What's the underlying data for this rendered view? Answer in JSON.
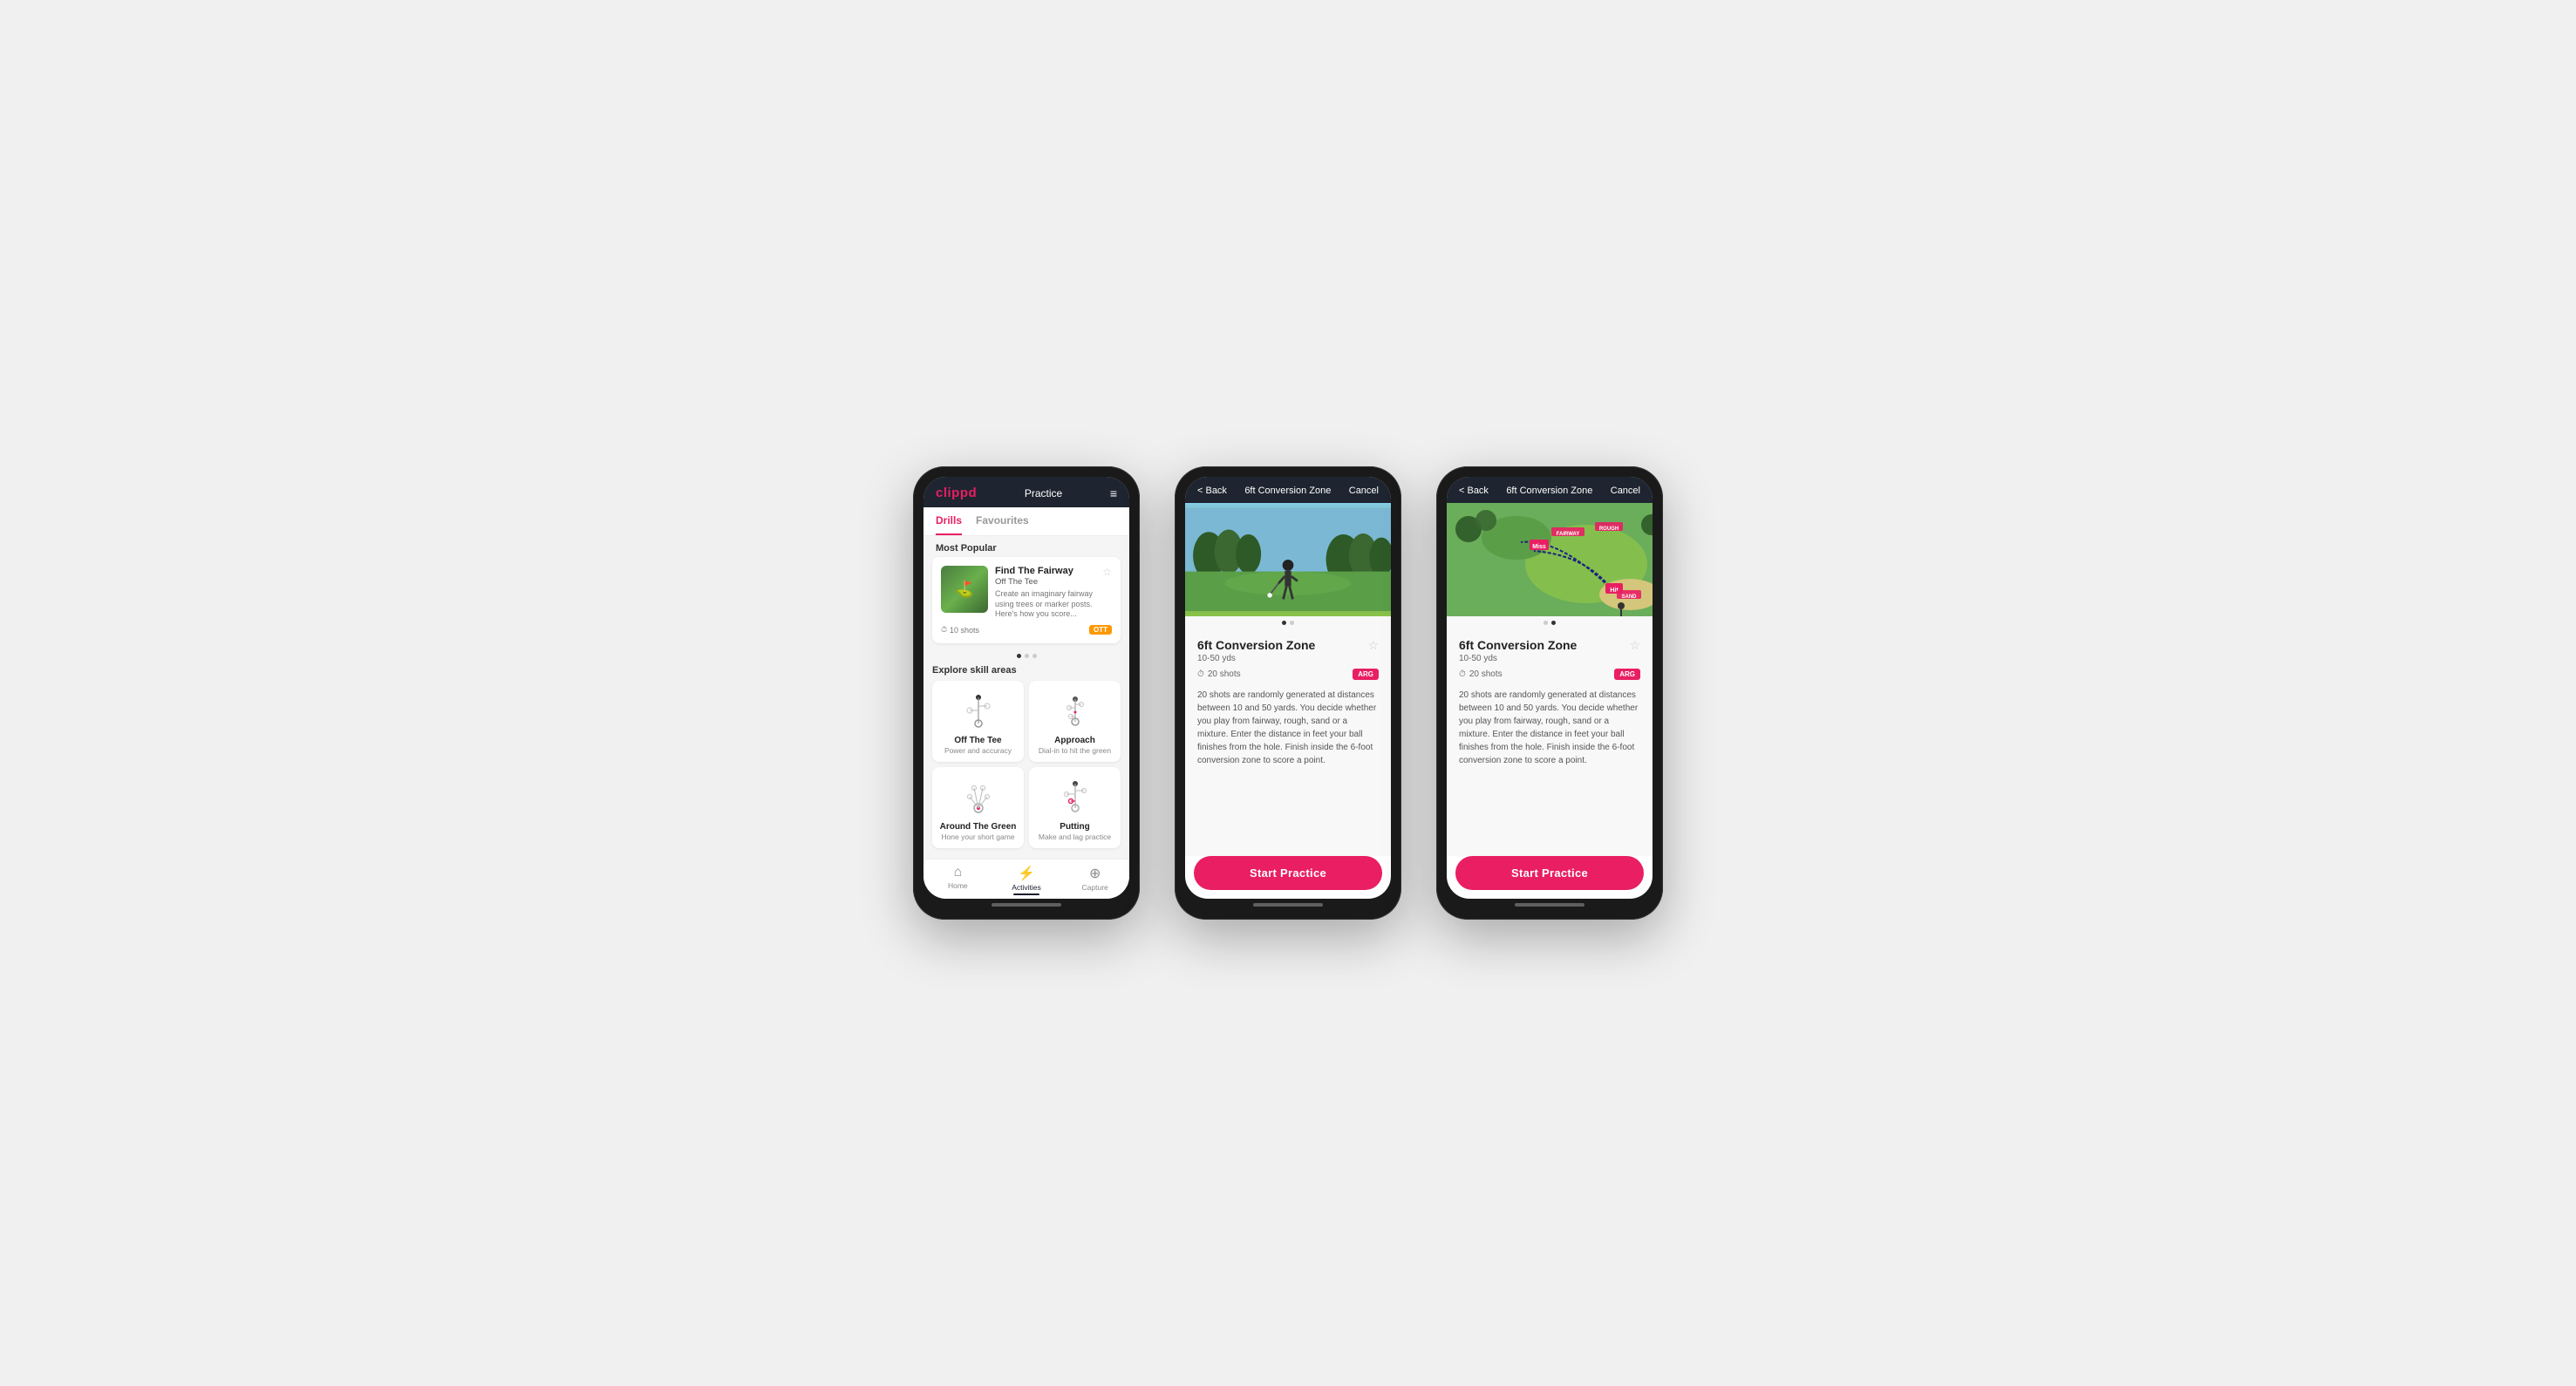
{
  "phones": [
    {
      "id": "phone-1",
      "header": {
        "logo": "clippd",
        "title": "Practice",
        "menu_icon": "≡"
      },
      "tabs": [
        {
          "label": "Drills",
          "active": true
        },
        {
          "label": "Favourites",
          "active": false
        }
      ],
      "most_popular_label": "Most Popular",
      "drill_card": {
        "title": "Find The Fairway",
        "subtitle": "Off The Tee",
        "description": "Create an imaginary fairway using trees or marker posts. Here's how you score...",
        "shots_label": "10 shots",
        "tag": "OTT",
        "star_icon": "☆",
        "dots": [
          true,
          false,
          false
        ]
      },
      "explore_label": "Explore skill areas",
      "skill_areas": [
        {
          "id": "ott",
          "label": "Off The Tee",
          "desc": "Power and accuracy"
        },
        {
          "id": "approach",
          "label": "Approach",
          "desc": "Dial-in to hit the green"
        },
        {
          "id": "arg",
          "label": "Around The Green",
          "desc": "Hone your short game"
        },
        {
          "id": "putting",
          "label": "Putting",
          "desc": "Make and lag practice"
        }
      ],
      "bottom_nav": [
        {
          "label": "Home",
          "icon": "⌂",
          "active": false
        },
        {
          "label": "Activities",
          "icon": "⚡",
          "active": true
        },
        {
          "label": "Capture",
          "icon": "⊕",
          "active": false
        }
      ]
    },
    {
      "id": "phone-2",
      "header": {
        "back_label": "< Back",
        "title": "6ft Conversion Zone",
        "cancel_label": "Cancel"
      },
      "image_type": "photo",
      "dots": [
        true,
        false
      ],
      "drill": {
        "title": "6ft Conversion Zone",
        "yds": "10-50 yds",
        "shots": "20 shots",
        "tag": "ARG",
        "star_icon": "☆",
        "description": "20 shots are randomly generated at distances between 10 and 50 yards. You decide whether you play from fairway, rough, sand or a mixture. Enter the distance in feet your ball finishes from the hole. Finish inside the 6-foot conversion zone to score a point."
      },
      "start_btn": "Start Practice"
    },
    {
      "id": "phone-3",
      "header": {
        "back_label": "< Back",
        "title": "6ft Conversion Zone",
        "cancel_label": "Cancel"
      },
      "image_type": "map",
      "dots": [
        false,
        true
      ],
      "drill": {
        "title": "6ft Conversion Zone",
        "yds": "10-50 yds",
        "shots": "20 shots",
        "tag": "ARG",
        "star_icon": "☆",
        "description": "20 shots are randomly generated at distances between 10 and 50 yards. You decide whether you play from fairway, rough, sand or a mixture. Enter the distance in feet your ball finishes from the hole. Finish inside the 6-foot conversion zone to score a point."
      },
      "start_btn": "Start Practice"
    }
  ],
  "map_labels": [
    "FAIRWAY",
    "ROUGH",
    "Miss",
    "Hit",
    "SAND"
  ],
  "clock_icon": "⏱"
}
